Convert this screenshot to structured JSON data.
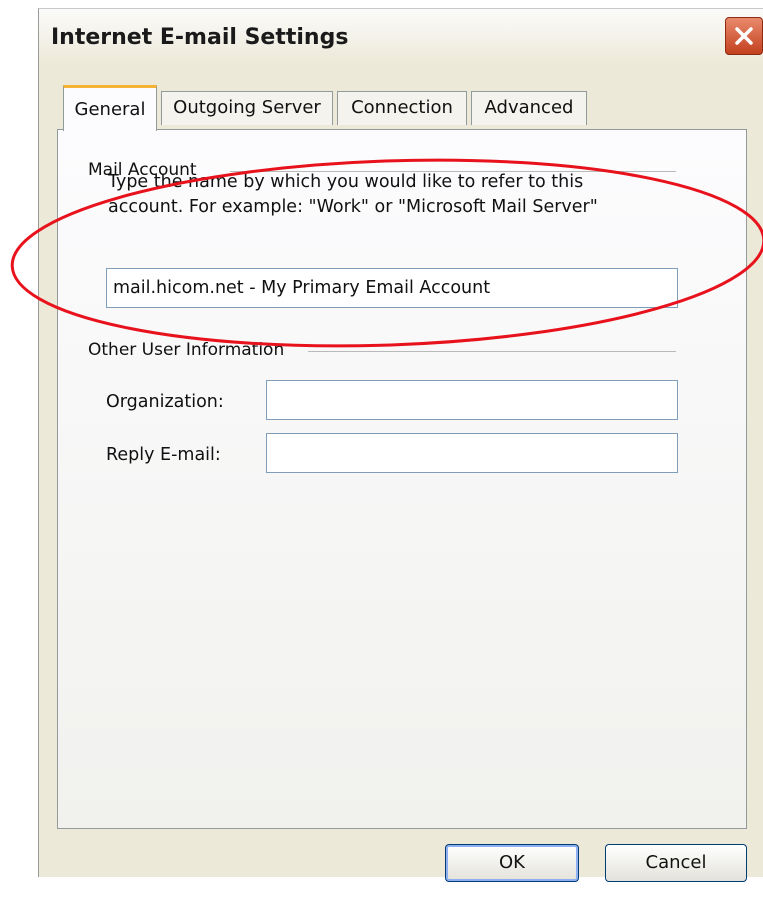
{
  "window": {
    "title": "Internet E-mail Settings"
  },
  "tabs": [
    {
      "label": "General",
      "active": true
    },
    {
      "label": "Outgoing Server",
      "active": false
    },
    {
      "label": "Connection",
      "active": false
    },
    {
      "label": "Advanced",
      "active": false
    }
  ],
  "mail_account": {
    "group_label": "Mail Account",
    "description_line1": "Type the name by which you would like to refer to this",
    "description_line2": "account.  For example: \"Work\" or \"Microsoft Mail Server\"",
    "account_name_value": "mail.hicom.net - My Primary Email Account"
  },
  "other_user_info": {
    "group_label": "Other User Information",
    "organization_label": "Organization:",
    "organization_value": "",
    "reply_email_label": "Reply E-mail:",
    "reply_email_value": ""
  },
  "buttons": {
    "ok_label": "OK",
    "cancel_label": "Cancel"
  },
  "annotation": {
    "color": "#e8121c"
  }
}
